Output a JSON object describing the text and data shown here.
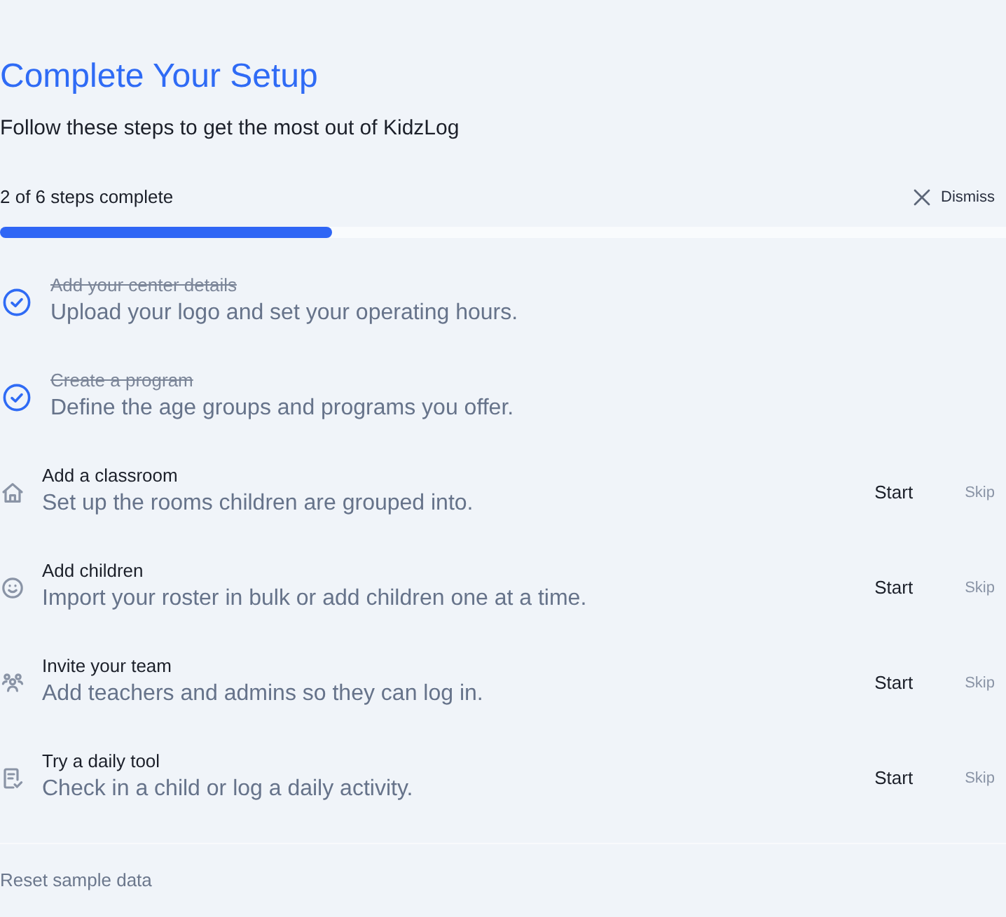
{
  "header": {
    "title": "Complete Your Setup",
    "subtitle": "Follow these steps to get the most out of KidzLog"
  },
  "progress": {
    "label": "2 of 6 steps complete",
    "dismiss": "Dismiss",
    "level": 0.33
  },
  "steps": [
    {
      "title": "Add your center details",
      "description": "Upload your logo and set your operating hours.",
      "completed": true
    },
    {
      "title": "Create a program",
      "description": "Define the age groups and programs you offer.",
      "completed": true
    },
    {
      "title": "Add a classroom",
      "description": "Set up the rooms children are grouped into.",
      "completed": false,
      "start": "Start",
      "skip": "Skip"
    },
    {
      "title": "Add children",
      "description": "Import your roster in bulk or add children one at a time.",
      "completed": false,
      "start": "Start",
      "skip": "Skip"
    },
    {
      "title": "Invite your team",
      "description": "Add teachers and admins so they can log in.",
      "completed": false,
      "start": "Start",
      "skip": "Skip"
    },
    {
      "title": "Try a daily tool",
      "description": "Check in a child or log a daily activity.",
      "completed": false,
      "start": "Start",
      "skip": "Skip"
    }
  ],
  "footer": {
    "reset_link": "Reset sample data"
  }
}
